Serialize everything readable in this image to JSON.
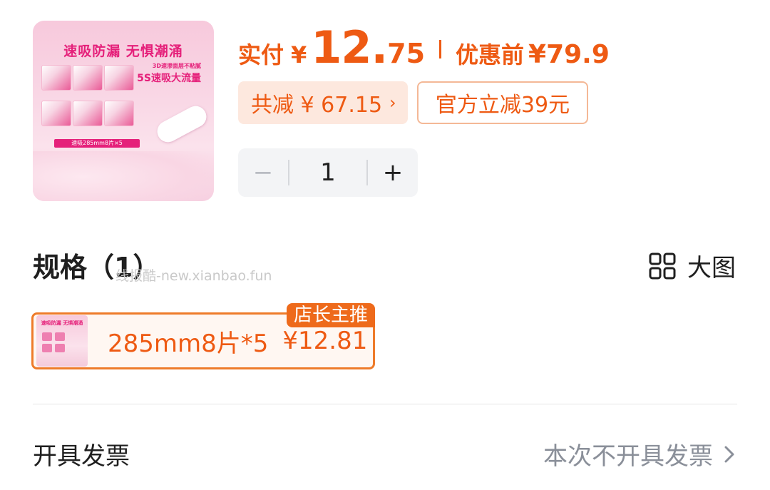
{
  "product": {
    "image_headline": "速吸防漏  无惧潮涌",
    "image_sub1": "3D速渗面层不粘腻",
    "image_sub2": "5S速吸大流量",
    "image_banner": "速吸285mm8片×5"
  },
  "price": {
    "label": "实付",
    "currency": "¥",
    "integer": "12.",
    "decimal": "75",
    "original_label": "优惠前",
    "original_price": "¥79.9"
  },
  "discount": {
    "total_label": "共减 ¥ 67.15",
    "chevron": "›",
    "official": "官方立减39元"
  },
  "stepper": {
    "minus": "−",
    "quantity": "1",
    "plus": "+"
  },
  "spec": {
    "title": "规格（1）",
    "watermark": "线报酷-new.xianbao.fun",
    "big_image_label": "大图",
    "item": {
      "name": "285mm8片*5",
      "price": "¥12.81",
      "badge": "店长主推",
      "thumb_text": "速吸防漏 无惧潮涌"
    }
  },
  "invoice": {
    "label": "开具发票",
    "value": "本次不开具发票"
  },
  "colors": {
    "accent": "#ee5a13",
    "accent_light_bg": "#fde8de",
    "stepper_bg": "#f3f4f6",
    "muted_text": "#8a8f99"
  }
}
